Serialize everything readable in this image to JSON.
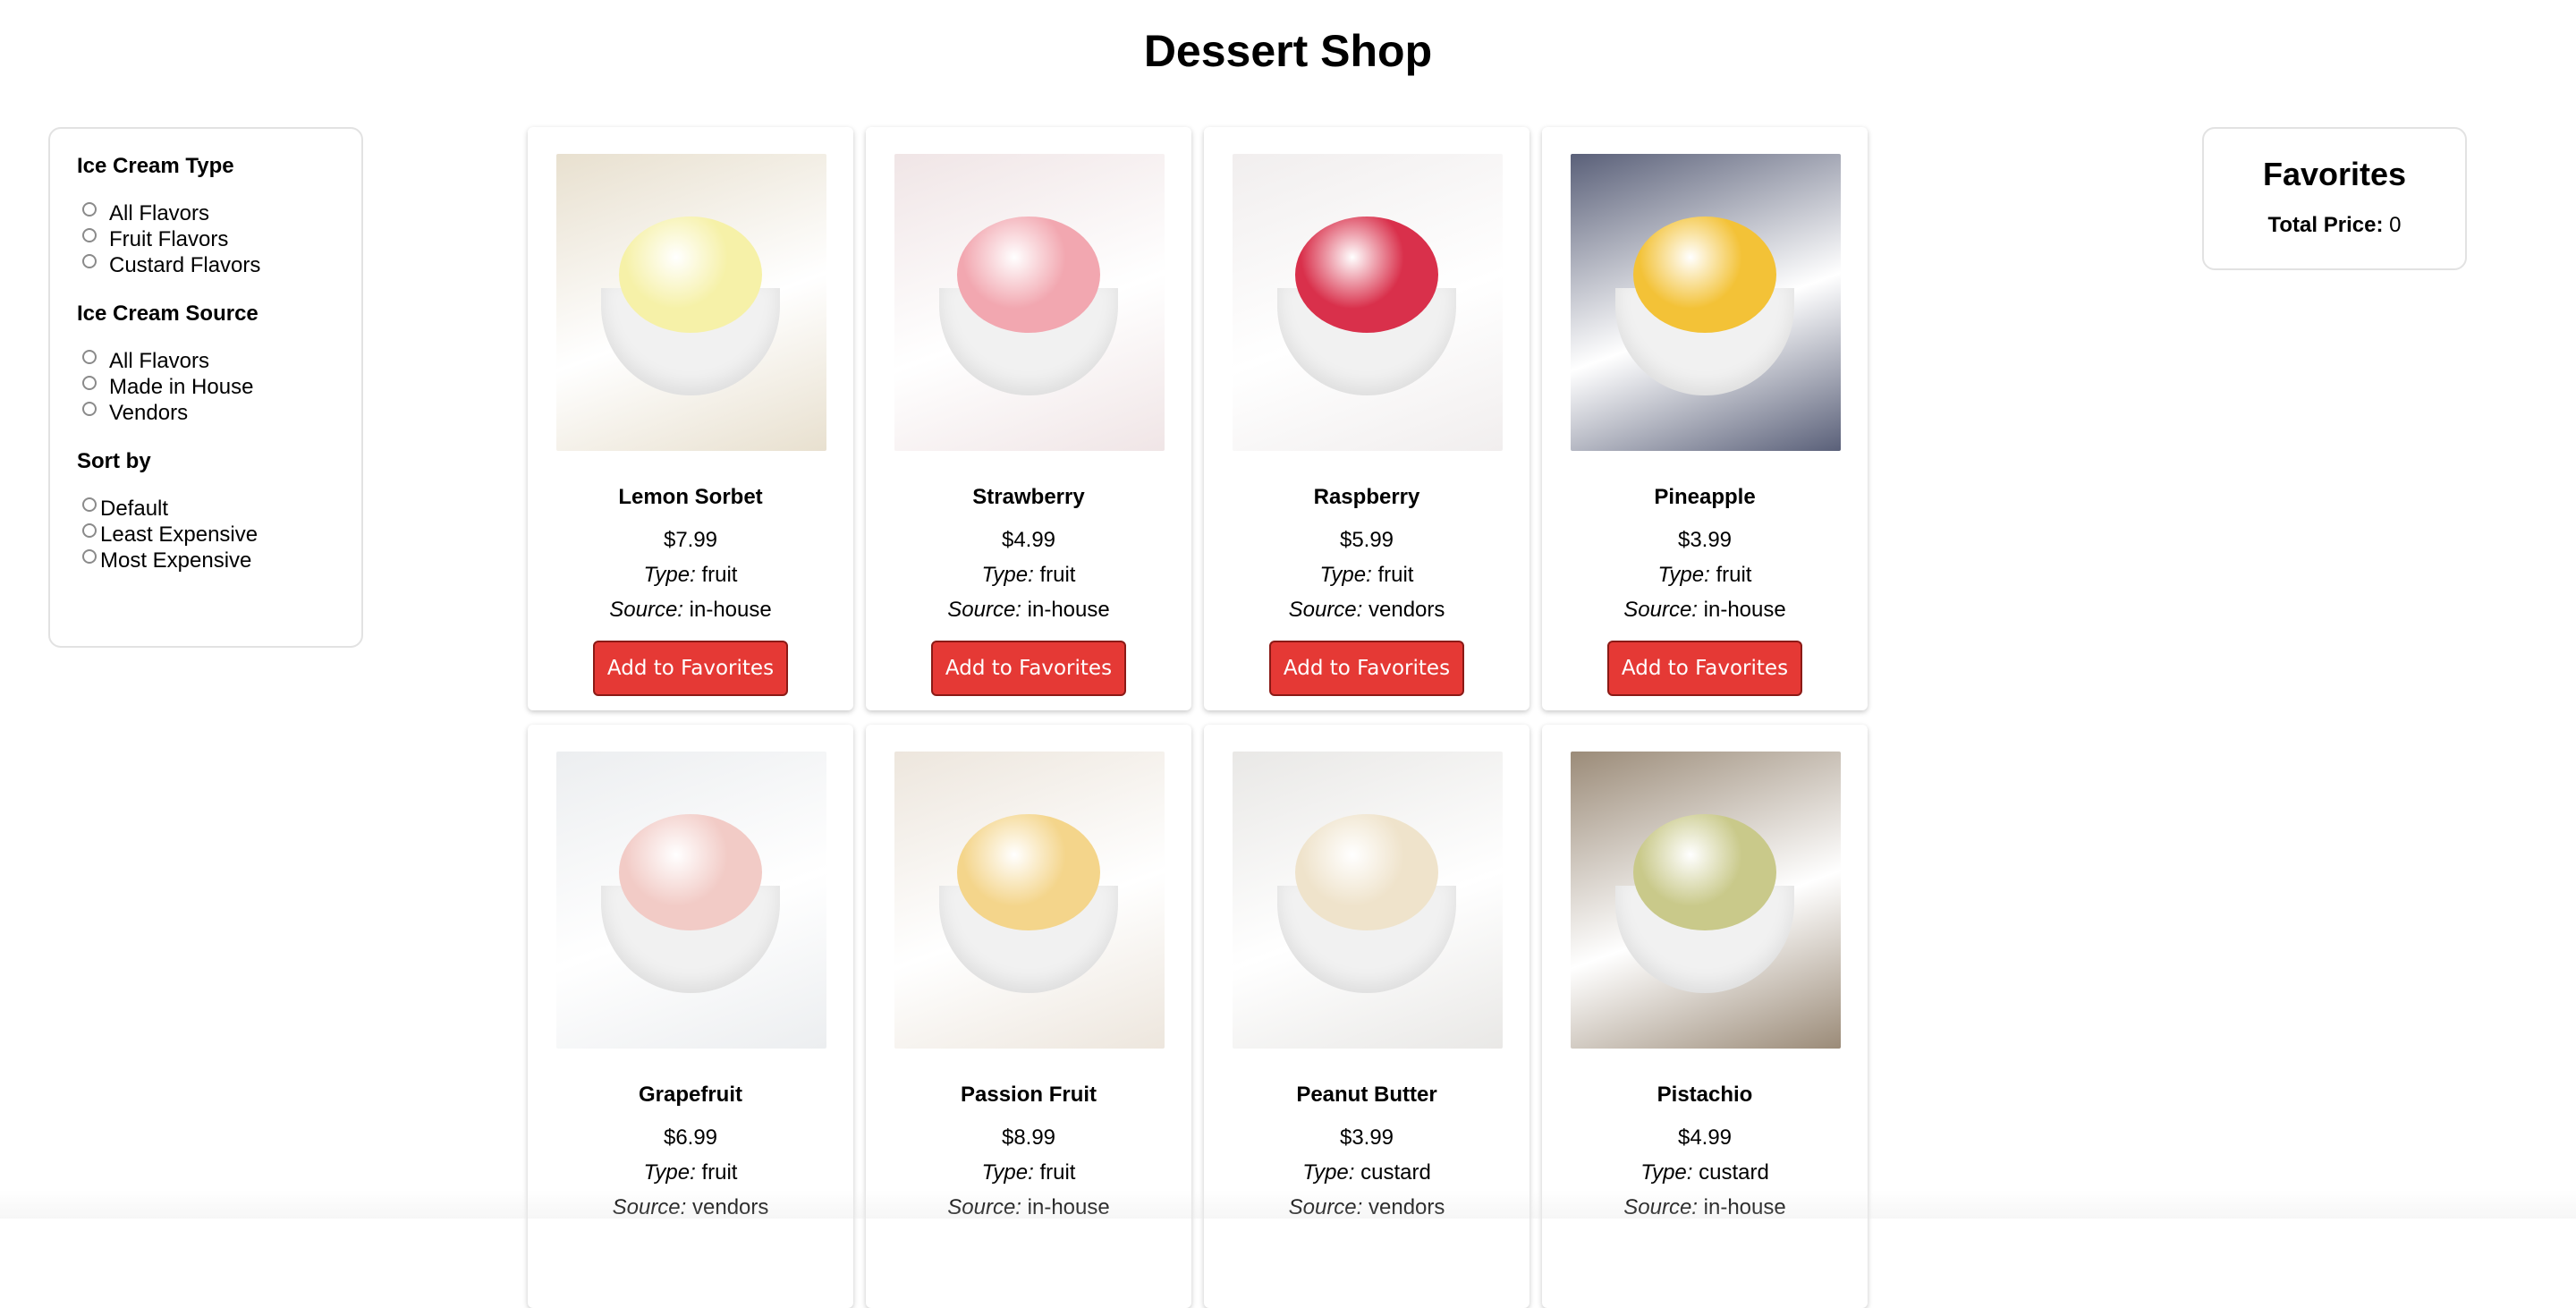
{
  "page": {
    "title": "Dessert Shop"
  },
  "filters": {
    "type": {
      "heading": "Ice Cream Type",
      "options": [
        "All Flavors",
        "Fruit Flavors",
        "Custard Flavors"
      ]
    },
    "source": {
      "heading": "Ice Cream Source",
      "options": [
        "All Flavors",
        "Made in House",
        "Vendors"
      ]
    },
    "sort": {
      "heading": "Sort by",
      "options": [
        "Default",
        "Least Expensive",
        "Most Expensive"
      ]
    }
  },
  "labels": {
    "type": "Type:",
    "source": "Source:",
    "add_button": "Add to Favorites"
  },
  "products": [
    {
      "name": "Lemon Sorbet",
      "price": "$7.99",
      "type": "fruit",
      "source": "in-house",
      "colors": [
        "#f6f1a8",
        "#e8e0cf"
      ]
    },
    {
      "name": "Strawberry",
      "price": "$4.99",
      "type": "fruit",
      "source": "in-house",
      "colors": [
        "#f2a7b0",
        "#f0e5e6"
      ]
    },
    {
      "name": "Raspberry",
      "price": "$5.99",
      "type": "fruit",
      "source": "vendors",
      "colors": [
        "#d9304b",
        "#f1eeee"
      ]
    },
    {
      "name": "Pineapple",
      "price": "$3.99",
      "type": "fruit",
      "source": "in-house",
      "colors": [
        "#f3c237",
        "#5a6079"
      ]
    },
    {
      "name": "Grapefruit",
      "price": "$6.99",
      "type": "fruit",
      "source": "vendors",
      "colors": [
        "#f2cbc6",
        "#eceef0"
      ]
    },
    {
      "name": "Passion Fruit",
      "price": "$8.99",
      "type": "fruit",
      "source": "in-house",
      "colors": [
        "#f4d58b",
        "#ede6dd"
      ]
    },
    {
      "name": "Peanut Butter",
      "price": "$3.99",
      "type": "custard",
      "source": "vendors",
      "colors": [
        "#efe3cb",
        "#e9e8e6"
      ]
    },
    {
      "name": "Pistachio",
      "price": "$4.99",
      "type": "custard",
      "source": "in-house",
      "colors": [
        "#c9c98a",
        "#9b8b78"
      ]
    }
  ],
  "favorites": {
    "title": "Favorites",
    "total_label": "Total Price:",
    "total_value": "0"
  }
}
